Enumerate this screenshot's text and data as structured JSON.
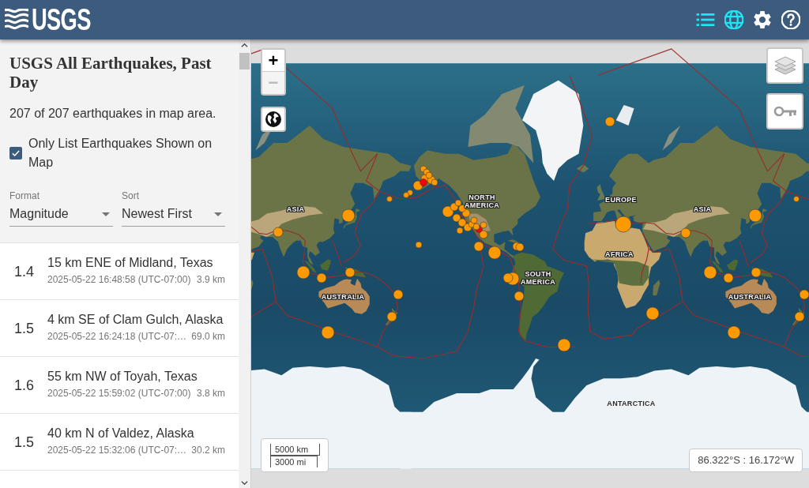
{
  "header": {
    "logo": "USGS",
    "tools": [
      {
        "kind": "list",
        "selected": true
      },
      {
        "kind": "map",
        "selected": true
      },
      {
        "kind": "settings",
        "selected": false
      },
      {
        "kind": "help",
        "selected": false
      }
    ]
  },
  "sidebar": {
    "title": "USGS All Earthquakes, Past Day",
    "summary": "207 of 207 earthquakes in map area.",
    "filter": {
      "label": "Only List Earthquakes Shown on Map",
      "checked": true
    },
    "selects": [
      {
        "label": "Format",
        "value": "Magnitude"
      },
      {
        "label": "Sort",
        "value": "Newest First"
      }
    ],
    "earthquakes": [
      {
        "magnitude": "1.4",
        "place": "15 km ENE of Midland, Texas",
        "time": "2025-05-22 16:48:58 (UTC-07:00)",
        "depth": "3.9 km"
      },
      {
        "magnitude": "1.5",
        "place": "4 km SE of Clam Gulch, Alaska",
        "time": "2025-05-22 16:24:18 (UTC-07:…",
        "depth": "69.0 km"
      },
      {
        "magnitude": "1.6",
        "place": "55 km NW of Toyah, Texas",
        "time": "2025-05-22 15:59:02 (UTC-07:00)",
        "depth": "3.8 km"
      },
      {
        "magnitude": "1.5",
        "place": "40 km N of Valdez, Alaska",
        "time": "2025-05-22 15:32:06 (UTC-07:…",
        "depth": "30.2 km"
      }
    ]
  },
  "map": {
    "zoom_in": {
      "label": "+",
      "disabled": false
    },
    "zoom_out": {
      "label": "−",
      "disabled": true
    },
    "labels": [
      "NORTH AMERICA",
      "EUROPE",
      "ASIA",
      "ASIA",
      "AFRICA",
      "SOUTH AMERICA",
      "AUSTRALIA",
      "AUSTRALIA",
      "ANTARCTICA"
    ],
    "markers": [
      {
        "color": "#ff9900"
      },
      {
        "color": "#ff9900"
      },
      {
        "color": "#ff9900"
      },
      {
        "color": "#ff9900"
      },
      {
        "color": "#ff9900"
      },
      {
        "color": "#ff9900"
      },
      {
        "color": "#ff9900"
      },
      {
        "color": "#ff9900"
      },
      {
        "color": "#ff9900"
      },
      {
        "color": "#ff9900"
      },
      {
        "color": "#ff0000"
      },
      {
        "color": "#ff9900"
      },
      {
        "color": "#ff9900"
      },
      {
        "color": "#ff9900"
      },
      {
        "color": "#ff9900"
      },
      {
        "color": "#ff9900"
      },
      {
        "color": "#ff9900"
      },
      {
        "color": "#ff9900"
      },
      {
        "color": "#ff9900"
      },
      {
        "color": "#ff9900"
      },
      {
        "color": "#ff9900"
      },
      {
        "color": "#ff9900"
      },
      {
        "color": "#ff9900"
      },
      {
        "color": "#ff9900"
      },
      {
        "color": "#ff9900"
      },
      {
        "color": "#ff9900"
      },
      {
        "color": "#ff9900"
      },
      {
        "color": "#ff0000"
      },
      {
        "color": "#ff9900"
      },
      {
        "color": "#ff9900"
      },
      {
        "color": "#ff9900"
      },
      {
        "color": "#ff9900"
      },
      {
        "color": "#ff9900"
      },
      {
        "color": "#ff9900"
      },
      {
        "color": "#ff9900"
      },
      {
        "color": "#ff9900"
      },
      {
        "color": "#ff9900"
      },
      {
        "color": "#ff9900"
      },
      {
        "color": "#ff9900"
      },
      {
        "color": "#ff9900"
      },
      {
        "color": "#ff9900"
      },
      {
        "color": "#ff9900"
      },
      {
        "color": "#ff9900"
      },
      {
        "color": "#ff9900"
      },
      {
        "color": "#ff9900"
      },
      {
        "color": "#ff9900"
      },
      {
        "color": "#ff9900"
      },
      {
        "color": "#ff9900"
      },
      {
        "color": "#ff9900"
      },
      {
        "color": "#ff9900"
      },
      {
        "color": "#ff9900"
      },
      {
        "color": "#ff9900"
      },
      {
        "color": "#ff9900"
      },
      {
        "color": "#ff9900"
      },
      {
        "color": "#ff9900"
      }
    ],
    "scale": [
      "5000 km",
      "3000 mi"
    ],
    "coordinates": "86.322°S : 16.172°W"
  }
}
